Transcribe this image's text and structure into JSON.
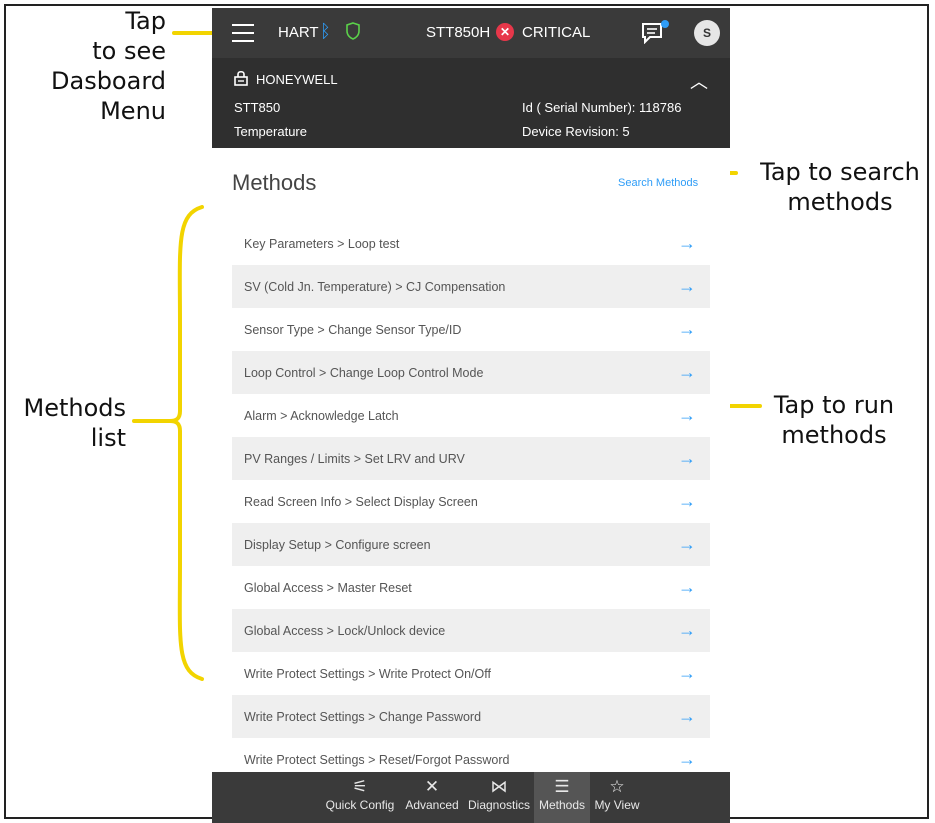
{
  "annotations": {
    "dashboard_menu": [
      "Tap",
      "to see",
      "Dasboard",
      "Menu"
    ],
    "search": [
      "Tap to search",
      "methods"
    ],
    "methods_list": [
      "Methods",
      "list"
    ],
    "run": [
      "Tap to run",
      "methods"
    ]
  },
  "topbar": {
    "protocol": "HART",
    "device": "STT850H",
    "status": "CRITICAL",
    "avatar": "S",
    "icons": [
      "menu-icon",
      "bluetooth-icon",
      "shield-icon",
      "critical-icon",
      "chat-icon"
    ]
  },
  "header": {
    "brand": "HONEYWELL",
    "model": "STT850",
    "type": "Temperature",
    "serial": "Id ( Serial Number): 118786",
    "revision": "Device Revision: 5"
  },
  "methods": {
    "title": "Methods",
    "search_label": "Search Methods",
    "items": [
      "Key Parameters > Loop test",
      "SV (Cold Jn. Temperature) >  CJ Compensation",
      "Sensor Type > Change Sensor Type/ID",
      "Loop Control > Change Loop Control Mode",
      "Alarm > Acknowledge Latch",
      "PV Ranges / Limits > Set LRV and URV",
      "Read Screen Info > Select Display Screen",
      "Display Setup > Configure screen",
      "Global Access > Master Reset",
      "Global Access > Lock/Unlock device",
      "Write Protect Settings > Write Protect On/Off",
      "Write Protect Settings > Change Password",
      "Write Protect Settings > Reset/Forgot Password"
    ]
  },
  "bottomnav": {
    "items": [
      "Quick Config",
      "Advanced",
      "Diagnostics",
      "Methods",
      "My View"
    ],
    "active": "Methods"
  },
  "colors": {
    "accent": "#2f9df7",
    "critical": "#e7374a",
    "annotation": "#f2d400"
  }
}
